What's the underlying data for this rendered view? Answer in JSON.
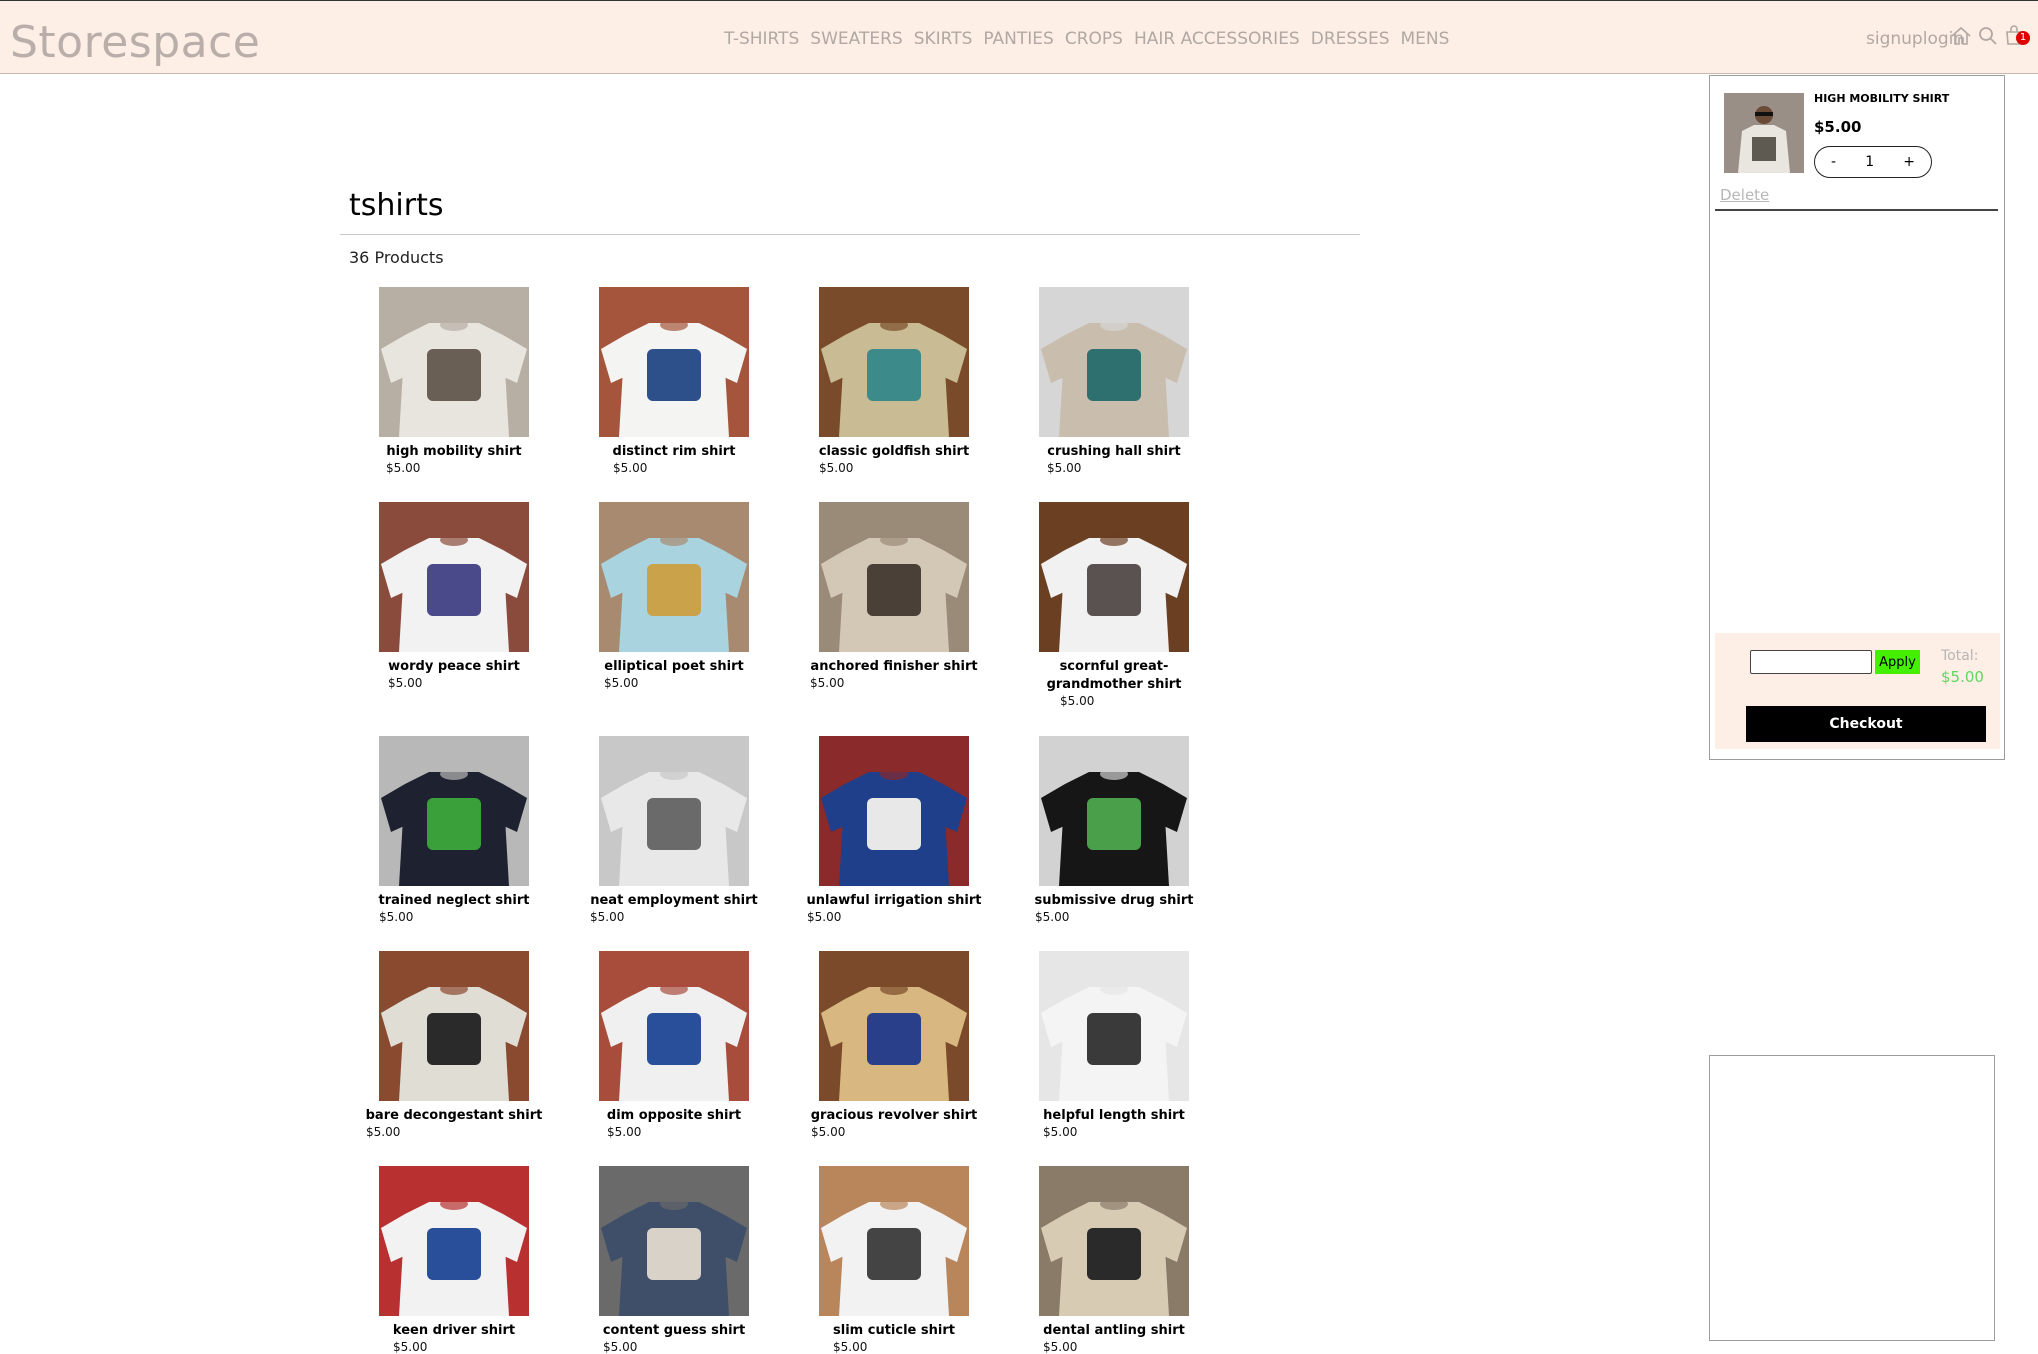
{
  "brand": "Storespace",
  "nav": [
    "T-SHIRTS",
    "SWEATERS",
    "SKIRTS",
    "PANTIES",
    "CROPS",
    "HAIR ACCESSORIES",
    "DRESSES",
    "MENS"
  ],
  "auth": {
    "signup": "signup",
    "login": "login"
  },
  "icons": {
    "home": "home-icon",
    "search": "search-icon",
    "cart": "cart-icon"
  },
  "cart_badge": "1",
  "category": {
    "title": "tshirts",
    "count": "36 Products"
  },
  "products": [
    {
      "name": "high mobility shirt",
      "price": "$5.00"
    },
    {
      "name": "distinct rim shirt",
      "price": "$5.00"
    },
    {
      "name": "classic goldfish shirt",
      "price": "$5.00"
    },
    {
      "name": "crushing hall shirt",
      "price": "$5.00"
    },
    {
      "name": "wordy peace shirt",
      "price": "$5.00"
    },
    {
      "name": "elliptical poet shirt",
      "price": "$5.00"
    },
    {
      "name": "anchored finisher shirt",
      "price": "$5.00"
    },
    {
      "name": "scornful great-grandmother shirt",
      "price": "$5.00"
    },
    {
      "name": "trained neglect shirt",
      "price": "$5.00"
    },
    {
      "name": "neat employment shirt",
      "price": "$5.00"
    },
    {
      "name": "unlawful irrigation shirt",
      "price": "$5.00"
    },
    {
      "name": "submissive drug shirt",
      "price": "$5.00"
    },
    {
      "name": "bare decongestant shirt",
      "price": "$5.00"
    },
    {
      "name": "dim opposite shirt",
      "price": "$5.00"
    },
    {
      "name": "gracious revolver shirt",
      "price": "$5.00"
    },
    {
      "name": "helpful length shirt",
      "price": "$5.00"
    },
    {
      "name": "keen driver shirt",
      "price": "$5.00"
    },
    {
      "name": "content guess shirt",
      "price": "$5.00"
    },
    {
      "name": "slim cuticle shirt",
      "price": "$5.00"
    },
    {
      "name": "dental antling shirt",
      "price": "$5.00"
    }
  ],
  "cart": {
    "item_name": "HIGH MOBILITY SHIRT",
    "item_price": "$5.00",
    "qty": "1",
    "minus": "-",
    "plus": "+",
    "delete": "Delete",
    "coupon_value": "",
    "apply": "Apply",
    "total_label": "Total:",
    "total_value": "$5.00",
    "checkout": "Checkout"
  },
  "colors": {
    "header_bg": "#fdeee6",
    "nav_text": "#b1a8a4",
    "apply_bg": "#44f000",
    "total_value": "#60d660",
    "badge": "#e00000",
    "checkout_bg": "#000000"
  }
}
